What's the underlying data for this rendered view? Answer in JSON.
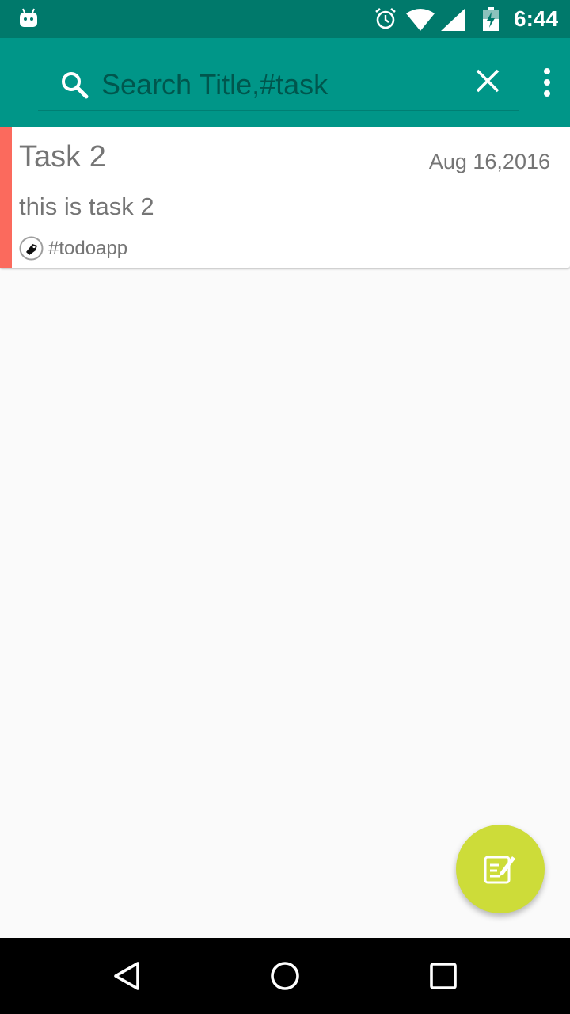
{
  "status_bar": {
    "time": "6:44",
    "icons": [
      "android-icon",
      "alarm-icon",
      "wifi-icon",
      "signal-icon",
      "battery-icon"
    ]
  },
  "app_bar": {
    "search": {
      "placeholder": "Search Title,#task",
      "value": ""
    },
    "icons": [
      "search-icon",
      "close-icon",
      "overflow-menu-icon"
    ]
  },
  "tasks": [
    {
      "title": "Task 2",
      "date": "Aug 16,2016",
      "description": "this is task 2",
      "tag": "#todoapp",
      "priority_color": "#fb6a5d"
    }
  ],
  "fab": {
    "icon": "edit-note-icon"
  },
  "nav_bar": {
    "icons": [
      "back-icon",
      "home-icon",
      "recents-icon"
    ]
  },
  "colors": {
    "status_bar": "#00796b",
    "app_bar": "#009688",
    "fab": "#cddc39",
    "background": "#fafafa",
    "text_secondary": "#757575"
  }
}
